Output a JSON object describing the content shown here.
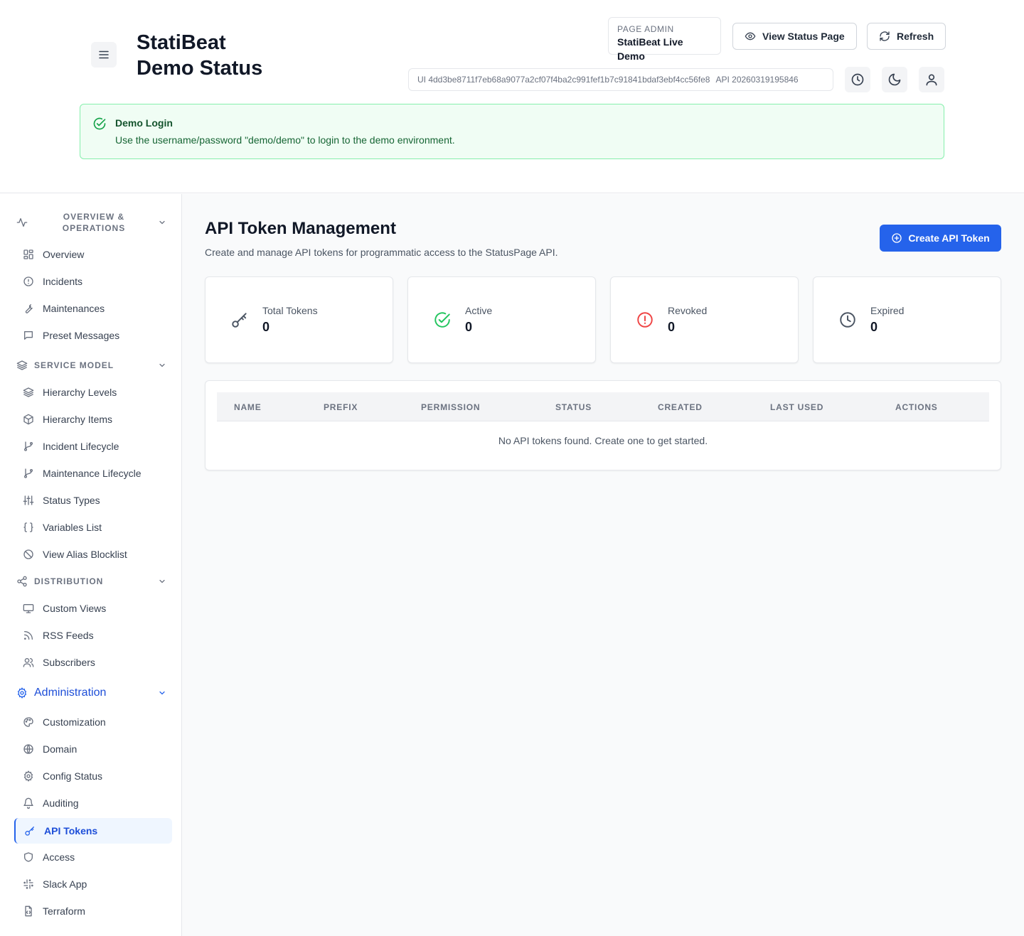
{
  "header": {
    "brand_line1": "StatiBeat",
    "brand_line2": "Demo Status",
    "page_admin_label": "PAGE ADMIN",
    "page_admin_value": "StatiBeat Live Demo",
    "view_status_label": "View Status Page",
    "refresh_label": "Refresh",
    "ui_version": "UI 4dd3be8711f7eb68a9077a2cf07f4ba2c991fef1b7c91841bdaf3ebf4cc56fe8",
    "api_version": "API 20260319195846",
    "icons": [
      "menu-icon",
      "eye-icon",
      "refresh-icon",
      "clock-icon",
      "moon-icon",
      "user-icon"
    ]
  },
  "alert": {
    "title": "Demo Login",
    "body": "Use the username/password \"demo/demo\" to login to the demo environment."
  },
  "sidebar": {
    "sections": [
      {
        "label_line1": "OVERVIEW &",
        "label_line2": "OPERATIONS",
        "icon": "activity-icon",
        "items": [
          {
            "label": "Overview",
            "icon": "dashboard-icon"
          },
          {
            "label": "Incidents",
            "icon": "alert-circle-icon"
          },
          {
            "label": "Maintenances",
            "icon": "wrench-icon"
          },
          {
            "label": "Preset Messages",
            "icon": "message-icon"
          }
        ]
      },
      {
        "label": "SERVICE MODEL",
        "icon": "layers-icon",
        "items": [
          {
            "label": "Hierarchy Levels",
            "icon": "layers-icon"
          },
          {
            "label": "Hierarchy Items",
            "icon": "box-icon"
          },
          {
            "label": "Incident Lifecycle",
            "icon": "git-branch-icon"
          },
          {
            "label": "Maintenance Lifecycle",
            "icon": "git-branch-icon"
          },
          {
            "label": "Status Types",
            "icon": "sliders-icon"
          },
          {
            "label": "Variables List",
            "icon": "braces-icon"
          },
          {
            "label": "View Alias Blocklist",
            "icon": "ban-icon"
          }
        ]
      },
      {
        "label": "DISTRIBUTION",
        "icon": "share-icon",
        "items": [
          {
            "label": "Custom Views",
            "icon": "monitor-icon"
          },
          {
            "label": "RSS Feeds",
            "icon": "rss-icon"
          },
          {
            "label": "Subscribers",
            "icon": "users-icon"
          }
        ]
      },
      {
        "label": "Administration",
        "icon": "gear-icon",
        "items": [
          {
            "label": "Customization",
            "icon": "palette-icon"
          },
          {
            "label": "Domain",
            "icon": "globe-icon"
          },
          {
            "label": "Config Status",
            "icon": "gear-icon"
          },
          {
            "label": "Auditing",
            "icon": "bell-icon"
          },
          {
            "label": "API Tokens",
            "icon": "key-icon",
            "active": true
          },
          {
            "label": "Access",
            "icon": "shield-icon"
          },
          {
            "label": "Slack App",
            "icon": "slack-icon"
          },
          {
            "label": "Terraform",
            "icon": "file-code-icon"
          }
        ]
      }
    ]
  },
  "main": {
    "title": "API Token Management",
    "subtitle": "Create and manage API tokens for programmatic access to the StatusPage API.",
    "create_label": "Create API Token",
    "stats": [
      {
        "label": "Total Tokens",
        "value": "0",
        "icon": "key-icon",
        "color": "#4b5563"
      },
      {
        "label": "Active",
        "value": "0",
        "icon": "check-circle-icon",
        "color": "#22c55e"
      },
      {
        "label": "Revoked",
        "value": "0",
        "icon": "alert-circle-icon",
        "color": "#ef4444"
      },
      {
        "label": "Expired",
        "value": "0",
        "icon": "clock-icon",
        "color": "#4b5563"
      }
    ],
    "table": {
      "columns": [
        "NAME",
        "PREFIX",
        "PERMISSION",
        "STATUS",
        "CREATED",
        "LAST USED",
        "ACTIONS"
      ],
      "empty": "No API tokens found. Create one to get started."
    }
  },
  "colors": {
    "primary": "#2563eb",
    "success": "#22c55e",
    "danger": "#ef4444",
    "alert_bg": "#f0fdf4",
    "alert_border": "#86efac"
  }
}
